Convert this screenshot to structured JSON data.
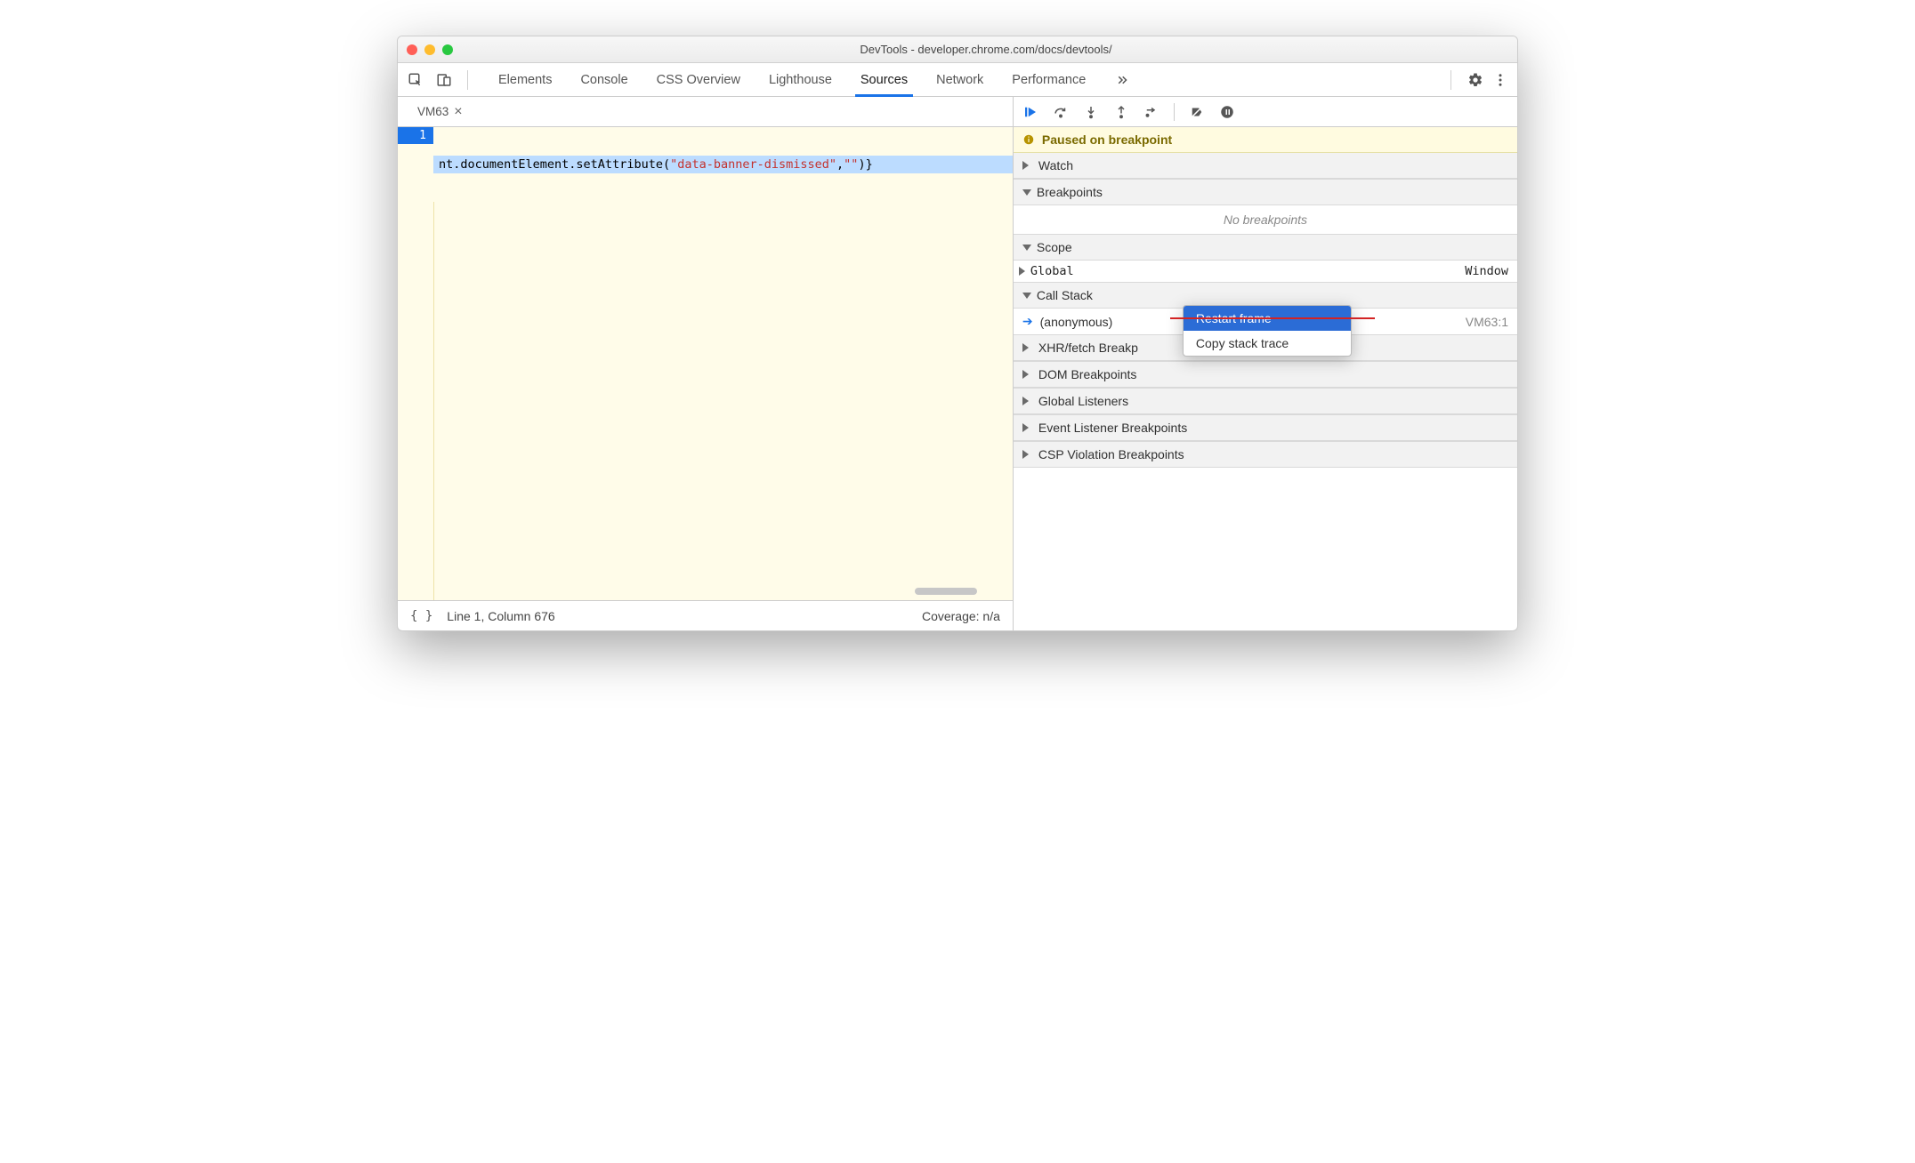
{
  "window": {
    "title": "DevTools - developer.chrome.com/docs/devtools/"
  },
  "tabs": {
    "items": [
      "Elements",
      "Console",
      "CSS Overview",
      "Lighthouse",
      "Sources",
      "Network",
      "Performance"
    ],
    "active": "Sources"
  },
  "editor": {
    "tab_label": "VM63",
    "line_number": "1",
    "code_prefix": "nt.documentElement.setAttribute(",
    "code_string": "\"data-banner-dismissed\"",
    "code_mid": ",",
    "code_string2": "\"\"",
    "code_suffix": ")}",
    "status_pos": "Line 1, Column 676",
    "status_coverage": "Coverage: n/a"
  },
  "debugger": {
    "paused_label": "Paused on breakpoint",
    "sections": {
      "watch": "Watch",
      "breakpoints": "Breakpoints",
      "no_breakpoints": "No breakpoints",
      "scope": "Scope",
      "scope_global": "Global",
      "scope_global_value": "Window",
      "callstack": "Call Stack",
      "call0_name": "(anonymous)",
      "call0_loc": "VM63:1",
      "xhr": "XHR/fetch Breakp",
      "dom": "DOM Breakpoints",
      "global_listeners": "Global Listeners",
      "event_listener": "Event Listener Breakpoints",
      "csp": "CSP Violation Breakpoints"
    },
    "context_menu": {
      "restart": "Restart frame",
      "copy": "Copy stack trace"
    }
  }
}
